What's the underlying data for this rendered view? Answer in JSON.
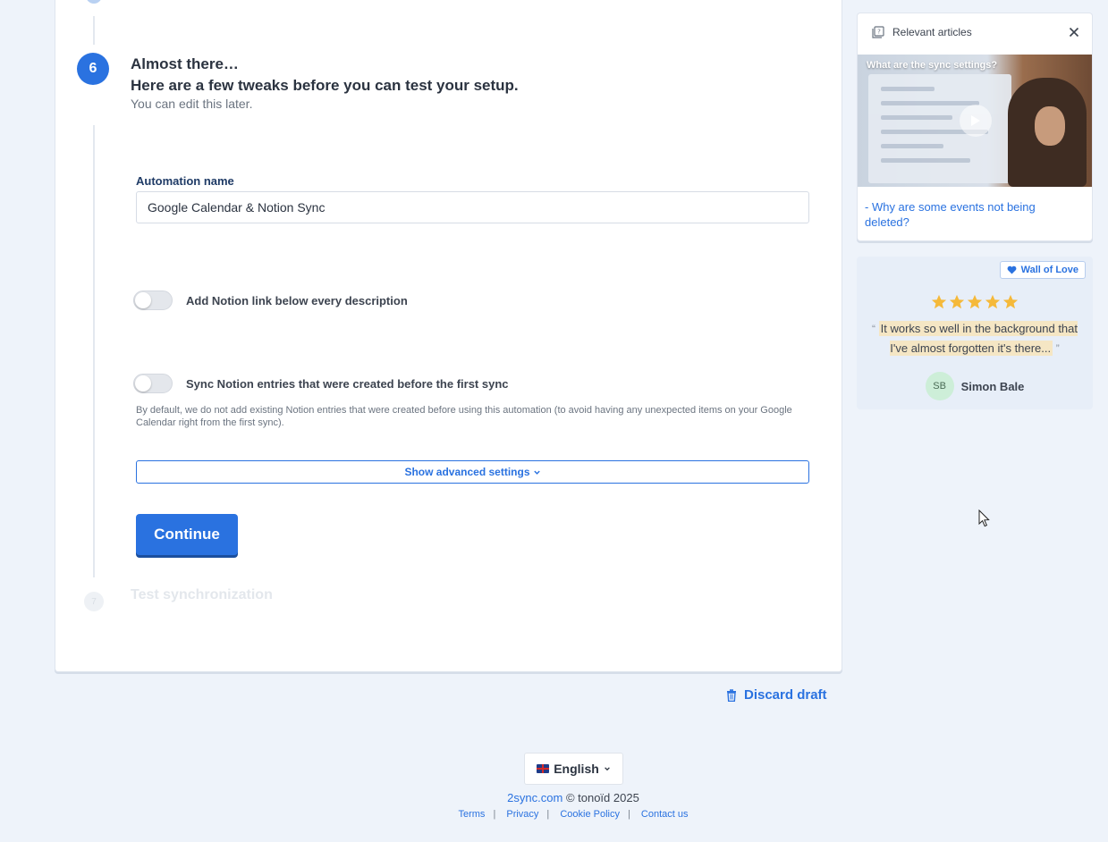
{
  "step": {
    "number": "6",
    "title_line1": "Almost there…",
    "title_line2": "Here are a few tweaks before you can test your setup.",
    "subtitle": "You can edit this later."
  },
  "form": {
    "automation_name_label": "Automation name",
    "automation_name_value": "Google Calendar & Notion Sync",
    "toggle_notion_link": {
      "label": "Add Notion link below every description",
      "enabled": false
    },
    "toggle_sync_existing": {
      "label": "Sync Notion entries that were created before the first sync",
      "enabled": false
    },
    "help_text": "By default, we do not add existing Notion entries that were created before using this automation (to avoid having any unexpected items on your Google Calendar right from the first sync).",
    "advanced_settings_label": "Show advanced settings",
    "continue_label": "Continue"
  },
  "next_step": {
    "number": "7",
    "title": "Test synchronization"
  },
  "discard_label": "Discard draft",
  "footer": {
    "language": "English",
    "site_link": "2sync.com",
    "copyright": "© tonoïd 2025",
    "links": [
      "Terms",
      "Privacy",
      "Cookie Policy",
      "Contact us"
    ]
  },
  "sidebar": {
    "articles": {
      "header": "Relevant articles",
      "video_title": "What are the sync settings?",
      "link": "- Why are some events not being deleted?"
    },
    "wall_of_love": {
      "badge": "Wall of Love",
      "rating": 5,
      "quote": "It works so well in the background that I've almost forgotten it's there...",
      "author_initials": "SB",
      "author_name": "Simon Bale"
    }
  },
  "colors": {
    "accent": "#2a72e0",
    "star": "#f5b93a",
    "page_bg": "#eef3fa"
  }
}
